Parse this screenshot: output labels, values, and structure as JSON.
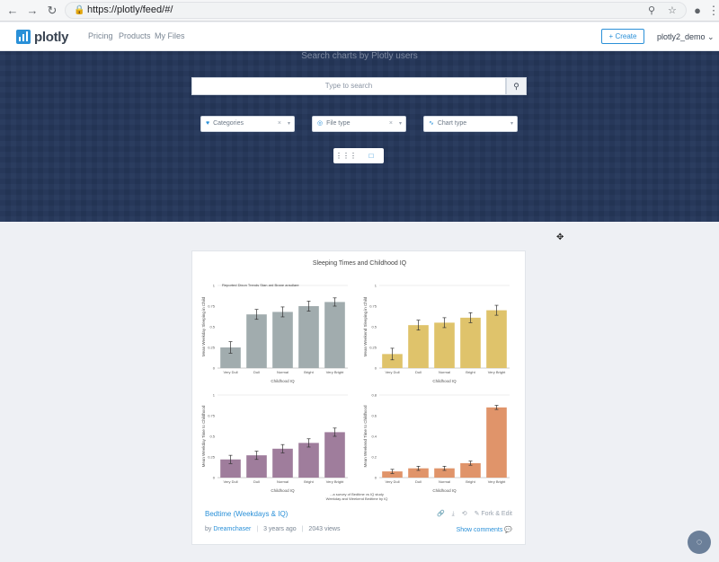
{
  "browser": {
    "url": "https://plotly/feed/#/",
    "back": "←",
    "forward": "→",
    "reload": "↻",
    "lock": "🔒",
    "zoom": "⚲",
    "star": "☆",
    "account": "●",
    "more": "⋮"
  },
  "header": {
    "logo_text": "plotly",
    "nav": [
      "Pricing",
      "Products",
      "My Files"
    ],
    "create_label": "+ Create",
    "user_label": "plotly2_demo ⌄"
  },
  "hero": {
    "title": "Search charts by Plotly users",
    "search_placeholder": "Type to search",
    "search_icon": "⚲",
    "filters": [
      {
        "icon": "♥",
        "label": "Categories",
        "clear": "×",
        "caret": "▾"
      },
      {
        "icon": "◎",
        "label": "File type",
        "clear": "×",
        "caret": "▾"
      },
      {
        "icon": "∿",
        "label": "Chart type",
        "clear": "",
        "caret": "▾"
      }
    ],
    "view_grid_icon": "⋮⋮⋮",
    "view_single_icon": "□"
  },
  "card": {
    "figure_title": "Sleeping Times and Childhood IQ",
    "panel1_subtitle": "Reported Dixon Trends Stan ard Brane ansdlare",
    "note_lines": [
      "...a survey of Bedtime vs IQ study",
      "Weekday and Weekend Bedtime by IQ"
    ],
    "title": "Bedtime (Weekdays & IQ)",
    "actions": [
      "🔗",
      "⤓",
      "⟲",
      "✎ Fork & Edit"
    ],
    "author": "Dreamchaser",
    "age": "3 years ago",
    "views": "2043 views",
    "show_comments": "Show comments 💬"
  },
  "chart_data": [
    {
      "type": "bar",
      "categories": [
        "Very Dull",
        "Dull",
        "Normal",
        "Bright",
        "Very Bright"
      ],
      "values": [
        0.25,
        0.65,
        0.68,
        0.75,
        0.8
      ],
      "errors": [
        0.07,
        0.06,
        0.06,
        0.06,
        0.05
      ],
      "color": "#a1acae",
      "xlabel": "Childhood IQ",
      "ylabel": "Mean Weekday Sleeping in Child",
      "ylim": [
        0,
        1
      ]
    },
    {
      "type": "bar",
      "categories": [
        "Very Dull",
        "Dull",
        "Normal",
        "Bright",
        "Very Bright"
      ],
      "values": [
        0.17,
        0.52,
        0.55,
        0.61,
        0.7
      ],
      "errors": [
        0.07,
        0.06,
        0.06,
        0.06,
        0.06
      ],
      "color": "#dfc36b",
      "xlabel": "Childhood IQ",
      "ylabel": "Mean Weekend Sleeping in Child",
      "ylim": [
        0,
        1
      ]
    },
    {
      "type": "bar",
      "categories": [
        "Very Dull",
        "Dull",
        "Normal",
        "Bright",
        "Very Bright"
      ],
      "values": [
        0.22,
        0.27,
        0.35,
        0.42,
        0.55
      ],
      "errors": [
        0.05,
        0.05,
        0.05,
        0.05,
        0.05
      ],
      "color": "#9f7d9c",
      "xlabel": "Childhood IQ",
      "ylabel": "Mean Weekday Time to Childhood",
      "ylim": [
        0,
        1
      ]
    },
    {
      "type": "bar",
      "categories": [
        "Very Dull",
        "Dull",
        "Normal",
        "Bright",
        "Very Bright"
      ],
      "values": [
        0.06,
        0.09,
        0.09,
        0.14,
        0.68
      ],
      "errors": [
        0.02,
        0.02,
        0.02,
        0.02,
        0.02
      ],
      "color": "#e0946a",
      "xlabel": "Childhood IQ",
      "ylabel": "Mean Weekend Time to Childhood",
      "ylim": [
        0,
        0.8
      ]
    }
  ]
}
